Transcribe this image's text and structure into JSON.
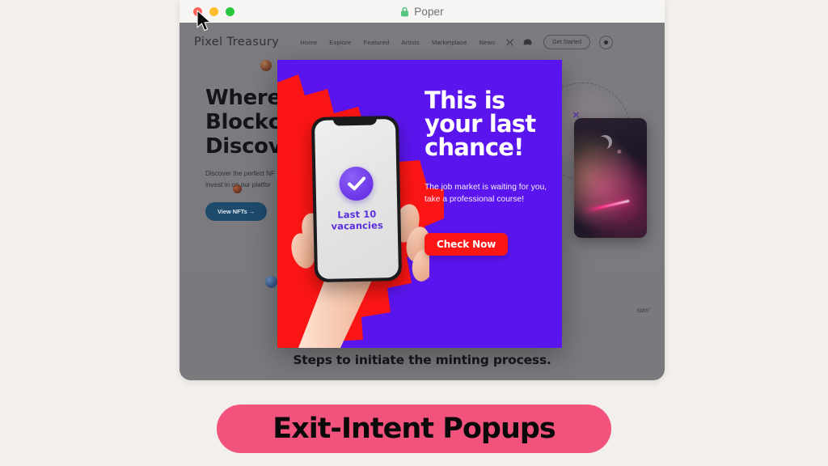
{
  "browser": {
    "title": "Poper",
    "lock_icon": "lock-icon",
    "traffic_lights": [
      "close-red",
      "minimize-yellow",
      "maximize-green"
    ]
  },
  "site": {
    "brand": "Pixel Treasury",
    "nav_links": [
      "Home",
      "Explore",
      "Featured",
      "Artists",
      "Marketplace",
      "News"
    ],
    "nav_icons": [
      "x-twitter-icon",
      "discord-icon"
    ],
    "get_started_label": "Get Started",
    "theme_toggle": "theme-toggle-icon",
    "hero": {
      "heading_line1": "Where",
      "heading_line2": "Blockch",
      "heading_line3": "Discove",
      "paragraph_line1": "Discover the perfect NF",
      "paragraph_line2": "invest in on our platfor",
      "cta_label": "View NFTs  →"
    },
    "decor_x": "✕",
    "lorem_fragment": "sum'",
    "bottom_caption": "Steps to initiate the minting process."
  },
  "popup": {
    "headline": "This is your last chance!",
    "body": "The job market is waiting for you, take a professional course!",
    "cta_label": "Check Now",
    "phone_text": "Last 10 vacancies",
    "check_icon": "check-circle-icon",
    "colors": {
      "background": "#5A15EE",
      "accent_shape": "#FC1515",
      "cta": "#FC1515",
      "phone_text": "#5A2FE0"
    }
  },
  "caption_banner": {
    "text": "Exit-Intent Popups",
    "background": "#F2537C",
    "text_color": "#0A0A0A"
  },
  "page": {
    "background": "#F2EFEC"
  },
  "cursor": {
    "icon": "mouse-pointer-icon"
  }
}
